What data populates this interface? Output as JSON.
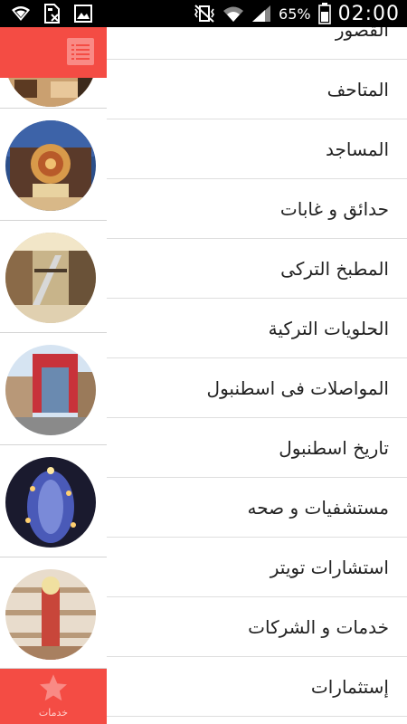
{
  "status_bar": {
    "icons": [
      "wifi-icon",
      "sim-blocked-icon",
      "image-icon",
      "vibrate-icon",
      "wifi-signal-icon",
      "cell-signal-icon"
    ],
    "battery_percent": "65%",
    "clock": "02:00"
  },
  "left_strip": {
    "menu_icon": "list-menu-icon",
    "thumbnails": [
      {
        "name": "mall-photo-1"
      },
      {
        "name": "mall-photo-2"
      },
      {
        "name": "mall-photo-3"
      },
      {
        "name": "mall-photo-4"
      },
      {
        "name": "mall-photo-5"
      },
      {
        "name": "mall-photo-6"
      }
    ],
    "footer": {
      "icon": "star-icon",
      "label": "خدمات"
    }
  },
  "menu": {
    "items": [
      {
        "label": "القصور"
      },
      {
        "label": "المتاحف"
      },
      {
        "label": "المساجد"
      },
      {
        "label": "حدائق و غابات"
      },
      {
        "label": "المطبخ التركى"
      },
      {
        "label": "الحلويات التركية"
      },
      {
        "label": "المواصلات فى اسطنبول"
      },
      {
        "label": "تاريخ اسطنبول"
      },
      {
        "label": "مستشفيات و صحه"
      },
      {
        "label": "استشارات تويتر"
      },
      {
        "label": "خدمات و الشركات"
      },
      {
        "label": "إستثمارات"
      }
    ]
  },
  "colors": {
    "accent": "#f44c44",
    "accent_light": "#f98a85",
    "status_bar": "#000000"
  }
}
